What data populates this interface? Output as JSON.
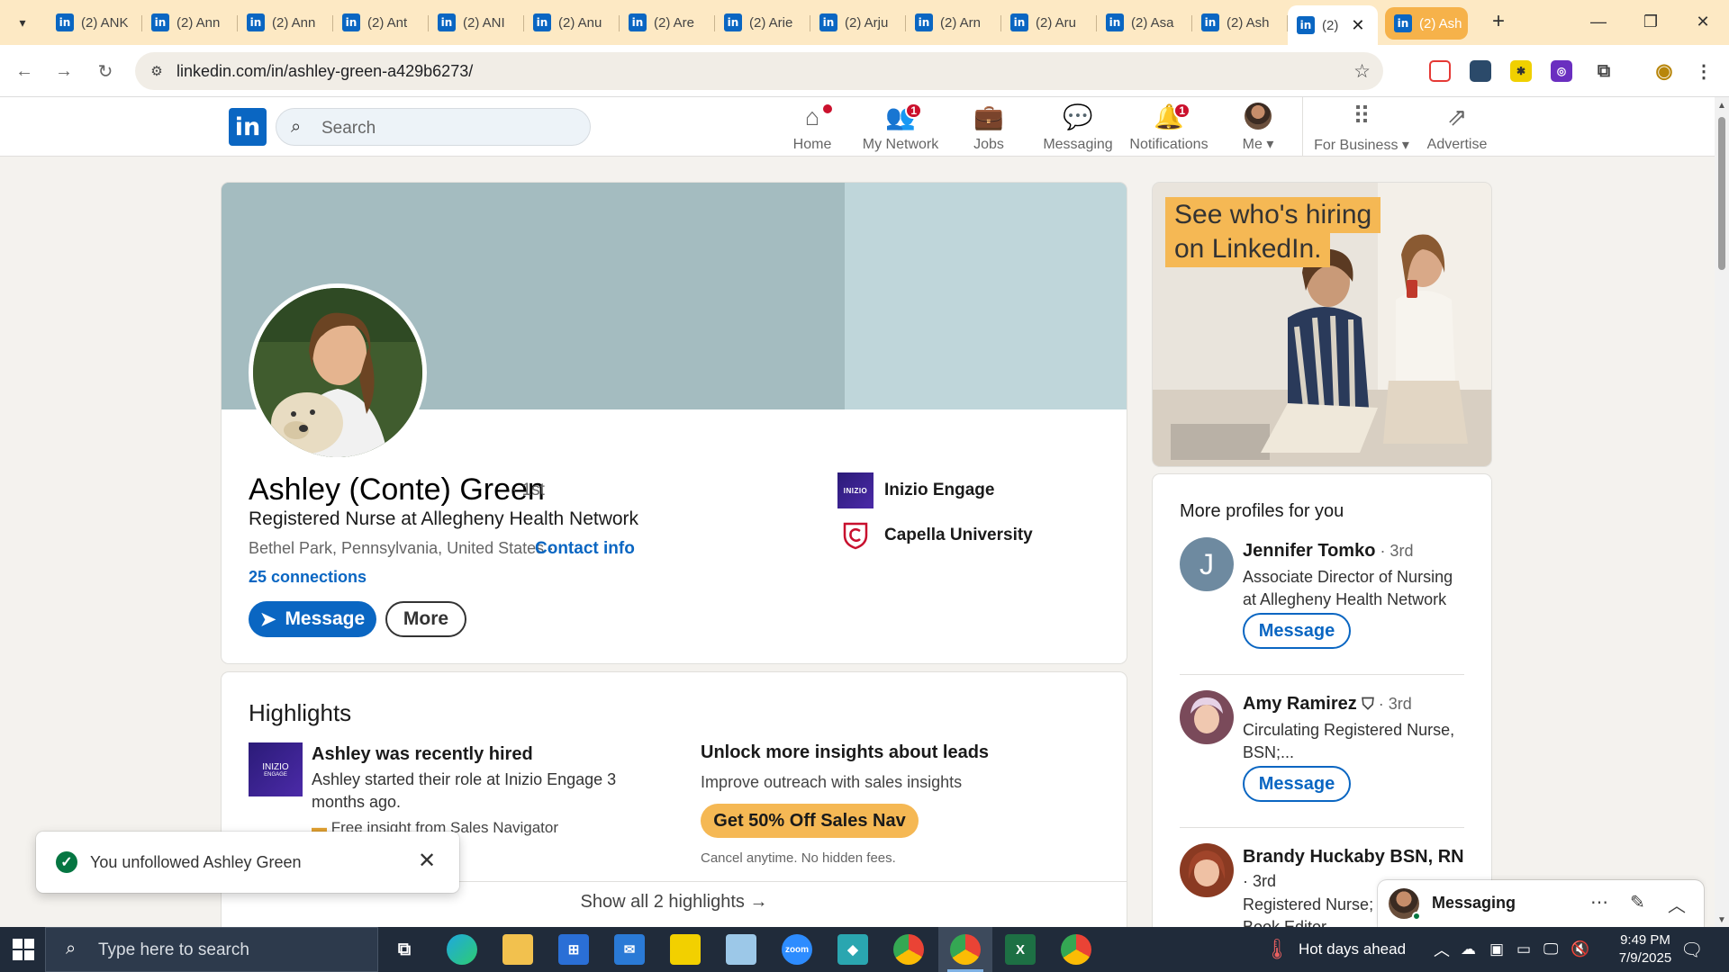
{
  "browser": {
    "tabs": [
      {
        "title": "(2) ANK"
      },
      {
        "title": "(2) Ann"
      },
      {
        "title": "(2) Ann"
      },
      {
        "title": "(2) Ant"
      },
      {
        "title": "(2) ANI"
      },
      {
        "title": "(2) Anu"
      },
      {
        "title": "(2) Are"
      },
      {
        "title": "(2) Arie"
      },
      {
        "title": "(2) Arju"
      },
      {
        "title": "(2) Arn"
      },
      {
        "title": "(2) Aru"
      },
      {
        "title": "(2) Asa"
      },
      {
        "title": "(2) Ash"
      },
      {
        "title": "(2)"
      },
      {
        "title": "(2) Ash"
      }
    ],
    "url": "linkedin.com/in/ashley-green-a429b6273/"
  },
  "linkedin": {
    "logo": "in",
    "search_placeholder": "Search",
    "nav": [
      {
        "label": "Home",
        "icon": "home-icon",
        "badge": ""
      },
      {
        "label": "My Network",
        "icon": "network-icon",
        "badge": "1"
      },
      {
        "label": "Jobs",
        "icon": "briefcase-icon",
        "badge": ""
      },
      {
        "label": "Messaging",
        "icon": "chat-icon",
        "badge": ""
      },
      {
        "label": "Notifications",
        "icon": "bell-icon",
        "badge": "1"
      },
      {
        "label": "Me",
        "icon": "avatar",
        "badge": ""
      },
      {
        "label": "For Business",
        "icon": "grid-icon",
        "badge": ""
      },
      {
        "label": "Advertise",
        "icon": "advertise-icon",
        "badge": ""
      }
    ]
  },
  "profile": {
    "name": "Ashley (Conte) Green",
    "degree": "· 1st",
    "headline": "Registered Nurse at Allegheny Health Network",
    "location": "Bethel Park, Pennsylvania, United States ·",
    "contact_info": "Contact info",
    "connections": "25 connections",
    "message_button": "Message",
    "more_button": "More",
    "orgs": [
      {
        "name": "Inizio Engage",
        "logo_text": "INIZIO"
      },
      {
        "name": "Capella University",
        "logo_text": ""
      }
    ]
  },
  "highlights": {
    "title": "Highlights",
    "logo_text": "INIZIO",
    "logo_subtext": "ENGAGE",
    "item_title": "Ashley was recently hired",
    "item_desc": "Ashley started their role at Inizio Engage 3 months ago.",
    "item_extra": "Free insight from Sales Navigator",
    "unlock_title": "Unlock more insights about leads",
    "unlock_desc": "Improve outreach with sales insights",
    "sales_button": "Get 50% Off Sales Nav",
    "cancel_note": "Cancel anytime. No hidden fees.",
    "show_all": "Show all 2 highlights →"
  },
  "ad": {
    "line1": "See who's hiring",
    "line2": "on LinkedIn."
  },
  "more_profiles": {
    "title": "More profiles for you",
    "people": [
      {
        "name": "Jennifer Tomko",
        "degree": " · 3rd",
        "title": "Associate Director of Nursing at Allegheny Health Network",
        "initial": "J",
        "button": "Message"
      },
      {
        "name": "Amy Ramirez",
        "degree": " · 3rd",
        "title": "Circulating Registered Nurse, BSN;...",
        "initial": "",
        "button": "Message"
      },
      {
        "name": "Brandy Huckaby BSN, RN",
        "degree": "· 3rd",
        "title": "Registered Nurse; Fiction Book Editor",
        "initial": "",
        "button": "Message"
      }
    ]
  },
  "messaging_dock": {
    "label": "Messaging"
  },
  "toast": {
    "message": "You unfollowed Ashley Green"
  },
  "taskbar": {
    "search_placeholder": "Type here to search",
    "weather": "Hot days ahead",
    "time": "9:49 PM",
    "date": "7/9/2025"
  },
  "colors": {
    "linkedin_blue": "#0a66c2",
    "tab_strip": "#fde9c4",
    "sales_nav_gold": "#f5b854",
    "notification_red": "#cb112d",
    "success_green": "#057642"
  }
}
